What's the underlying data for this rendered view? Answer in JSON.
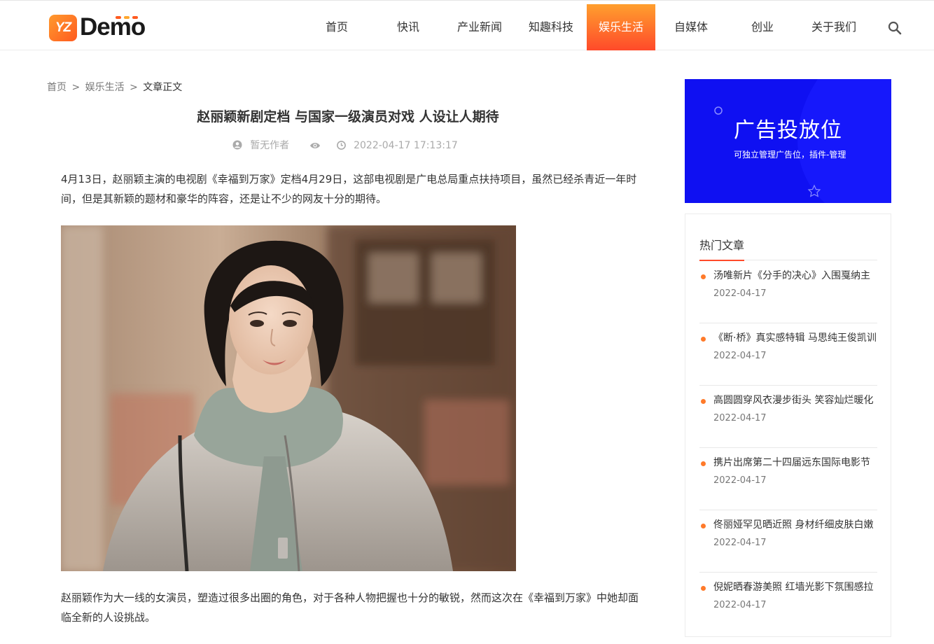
{
  "logo": {
    "badge": "YZ",
    "text": "Demo"
  },
  "nav": {
    "items": [
      "首页",
      "快讯",
      "产业新闻",
      "知趣科技",
      "娱乐生活",
      "自媒体",
      "创业",
      "关于我们"
    ],
    "active": "娱乐生活"
  },
  "breadcrumb": {
    "home": "首页",
    "category": "娱乐生活",
    "current": "文章正文",
    "sep": ">"
  },
  "article": {
    "title": "赵丽颖新剧定档 与国家一级演员对戏 人设让人期待",
    "author": "暂无作者",
    "datetime": "2022-04-17 17:13:17",
    "para1": "4月13日，赵丽颖主演的电视剧《幸福到万家》定档4月29日，这部电视剧是广电总局重点扶持项目，虽然已经杀青近一年时间，但是其新颖的题材和豪华的阵容，还是让不少的网友十分的期待。",
    "para2": "赵丽颖作为大一线的女演员，塑造过很多出圈的角色，对于各种人物把握也十分的敏锐，然而这次在《幸福到万家》中她却面临全新的人设挑战。"
  },
  "ad": {
    "title": "广告投放位",
    "subtitle": "可独立管理广告位，插件-管理",
    "background": "#0f10f2"
  },
  "hot": {
    "title": "热门文章",
    "items": [
      {
        "title": "汤唯新片《分手的决心》入围戛纳主",
        "date": "2022-04-17"
      },
      {
        "title": "《断·桥》真实感特辑 马思纯王俊凯训",
        "date": "2022-04-17"
      },
      {
        "title": "高圆圆穿风衣漫步街头 笑容灿烂暖化",
        "date": "2022-04-17"
      },
      {
        "title": "携片出席第二十四届远东国际电影节",
        "date": "2022-04-17"
      },
      {
        "title": "佟丽娅罕见晒近照 身材纤细皮肤白嫩",
        "date": "2022-04-17"
      },
      {
        "title": "倪妮晒春游美照 红墙光影下氛围感拉",
        "date": "2022-04-17"
      }
    ]
  },
  "colors": {
    "accent_start": "#ff9f2e",
    "accent_end": "#ff4a2a",
    "dot": "#ff7a2a"
  },
  "icons": {
    "search": "search-icon",
    "author": "user-icon",
    "views": "eye-icon",
    "time": "clock-icon"
  }
}
